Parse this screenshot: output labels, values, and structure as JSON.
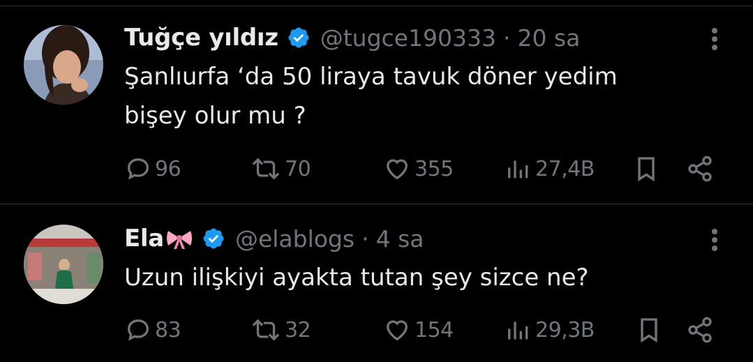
{
  "tweets": [
    {
      "name": "Tuğçe yıldız",
      "handle": "@tugce190333",
      "separator": "·",
      "time": "20 sa",
      "text_lines": [
        "Şanlıurfa ‘da 50 liraya tavuk döner yedim",
        "bişey olur mu ?"
      ],
      "replies": "96",
      "retweets": "70",
      "likes": "355",
      "views": "27,4B",
      "icons": [
        "verified-badge-icon",
        "more-icon",
        "reply-icon",
        "retweet-icon",
        "like-icon",
        "views-icon",
        "bookmark-icon",
        "share-icon"
      ]
    },
    {
      "name": "Ela",
      "name_emoji": "ribbon-bow",
      "handle": "@elablogs",
      "separator": "·",
      "time": "4 sa",
      "text_lines": [
        "Uzun ilişkiyi ayakta tutan şey sizce ne?"
      ],
      "replies": "83",
      "retweets": "32",
      "likes": "154",
      "views": "29,3B",
      "icons": [
        "verified-badge-icon",
        "more-icon",
        "reply-icon",
        "retweet-icon",
        "like-icon",
        "views-icon",
        "bookmark-icon",
        "share-icon"
      ]
    }
  ],
  "colors": {
    "background": "#000000",
    "text": "#e7e9ea",
    "muted": "#71767b",
    "verified": "#1d9bf0",
    "divider": "#2f3336"
  }
}
